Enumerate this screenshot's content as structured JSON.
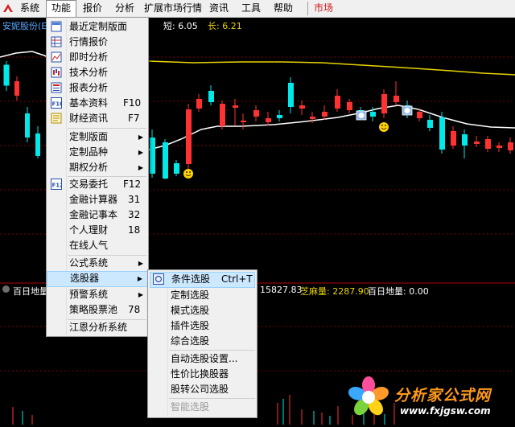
{
  "menubar": {
    "items": [
      {
        "label": "系统"
      },
      {
        "label": "功能"
      },
      {
        "label": "报价"
      },
      {
        "label": "分析"
      },
      {
        "label": "扩展市场行情"
      },
      {
        "label": "资讯"
      },
      {
        "label": "工具"
      },
      {
        "label": "帮助"
      },
      {
        "label": "市场"
      }
    ]
  },
  "chart": {
    "stock_name": "安妮股份(E",
    "ma_short_label": "短: 6.05",
    "ma_long_label": "长: 6.21",
    "sub_indicator": "百日地量",
    "sub_indicator_short": "百日地量",
    "value1": "15827.83",
    "value2_label": "芝麻量: 2287.90",
    "value3_label": "百日地量: 0.00",
    "colors": {
      "up": "#ff3232",
      "down": "#00e8e8",
      "ma_short": "#ffffff",
      "ma_long": "#e8d400"
    }
  },
  "function_menu": {
    "items": [
      {
        "label": "最近定制版面",
        "shortcut": "",
        "icon": "layout-icon"
      },
      {
        "label": "行情报价",
        "shortcut": "",
        "icon": "quote-grid-icon"
      },
      {
        "label": "即时分析",
        "shortcut": "",
        "icon": "line-chart-icon"
      },
      {
        "label": "技术分析",
        "shortcut": "",
        "icon": "candlestick-icon"
      },
      {
        "label": "报表分析",
        "shortcut": "",
        "icon": "report-icon"
      },
      {
        "label": "基本资料",
        "shortcut": "F10",
        "icon": "f10-icon"
      },
      {
        "label": "财经资讯",
        "shortcut": "F7",
        "icon": "news-icon"
      },
      {
        "label": "定制版面",
        "shortcut": "",
        "submenu": true
      },
      {
        "label": "定制品种",
        "shortcut": "",
        "submenu": true
      },
      {
        "label": "期权分析",
        "shortcut": "",
        "submenu": true
      },
      {
        "label": "交易委托",
        "shortcut": "F12",
        "icon": "f12-icon"
      },
      {
        "label": "金融计算器",
        "shortcut": "31"
      },
      {
        "label": "金融记事本",
        "shortcut": "32"
      },
      {
        "label": "个人理财",
        "shortcut": "18"
      },
      {
        "label": "在线人气",
        "shortcut": ""
      },
      {
        "label": "公式系统",
        "shortcut": "",
        "submenu": true
      },
      {
        "label": "选股器",
        "shortcut": "",
        "submenu": true,
        "highlighted": true
      },
      {
        "label": "预警系统",
        "shortcut": "",
        "submenu": true
      },
      {
        "label": "策略股票池",
        "shortcut": "78"
      },
      {
        "label": "江恩分析系统",
        "shortcut": ""
      }
    ]
  },
  "selector_menu": {
    "items": [
      {
        "label": "条件选股",
        "shortcut": "Ctrl+T",
        "highlighted": true,
        "icon": "condition-select-icon"
      },
      {
        "label": "定制选股",
        "shortcut": ""
      },
      {
        "label": "模式选股",
        "shortcut": ""
      },
      {
        "label": "插件选股",
        "shortcut": ""
      },
      {
        "label": "综合选股",
        "shortcut": ""
      },
      {
        "label": "自动选股设置...",
        "shortcut": ""
      },
      {
        "label": "性价比换股器",
        "shortcut": ""
      },
      {
        "label": "股转公司选股",
        "shortcut": ""
      },
      {
        "label": "智能选股",
        "shortcut": "",
        "disabled": true
      }
    ]
  },
  "watermark": {
    "name": "分析家公式网",
    "url": "www.fxjgsw.com"
  }
}
